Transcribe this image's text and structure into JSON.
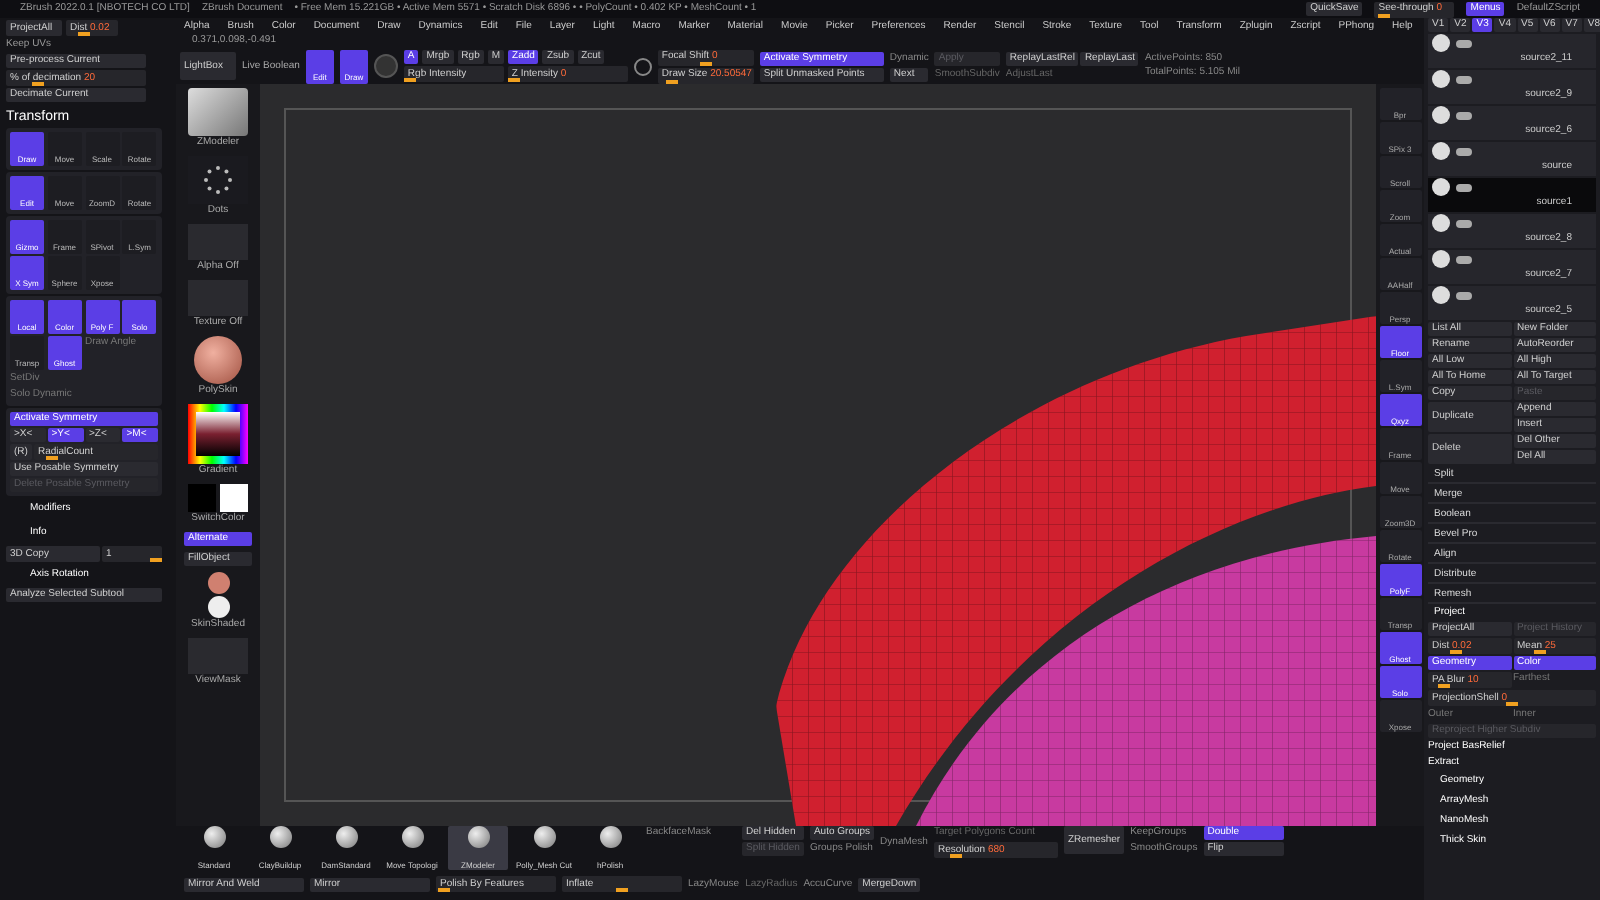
{
  "title_bar": {
    "app": "ZBrush 2022.0.1 [NBOTECH CO LTD]",
    "document": "ZBrush Document",
    "stats": "• Free Mem 15.221GB • Active Mem 5571 • Scratch Disk 6896 • • PolyCount • 0.402 KP • MeshCount • 1",
    "quick_save": "QuickSave",
    "see_through": {
      "label": "See-through",
      "value": "0",
      "level": 0.05
    },
    "menus_button": {
      "label": "Menus",
      "selected": true
    },
    "script": "DefaultZScript"
  },
  "menu_bar": [
    "Alpha",
    "Brush",
    "Color",
    "Document",
    "Draw",
    "Dynamics",
    "Edit",
    "File",
    "Layer",
    "Light",
    "Macro",
    "Marker",
    "Material",
    "Movie",
    "Picker",
    "Preferences",
    "Render",
    "Stencil",
    "Stroke",
    "Texture",
    "Tool",
    "Transform",
    "Zplugin",
    "Zscript",
    "PPhong",
    "Help"
  ],
  "decimation": {
    "project_all": "ProjectAll",
    "dist": {
      "label": "Dist",
      "value": "0.02",
      "level": 0.3
    },
    "keep_uvs": "Keep UVs",
    "pre_process": "Pre-process Current",
    "percent": {
      "label": "% of decimation",
      "value": "20",
      "level": 0.2
    },
    "decimate": "Decimate Current"
  },
  "toolbar": {
    "coordinates": "0.371,0.098,-0.491",
    "lightbox": "LightBox",
    "live_boolean": "Live Boolean",
    "modes": [
      {
        "label": "Edit",
        "selected": true
      },
      {
        "label": "Draw",
        "selected": true
      }
    ],
    "channels": [
      {
        "label": "A",
        "selected": true
      },
      {
        "label": "Mrgb",
        "selected": false
      },
      {
        "label": "Rgb",
        "selected": false
      },
      {
        "label": "M",
        "selected": false
      },
      {
        "label": "Zadd",
        "selected": true
      },
      {
        "label": "Zsub",
        "selected": false
      },
      {
        "label": "Zcut",
        "selected": false
      }
    ],
    "rgb_intensity": {
      "label": "Rgb Intensity",
      "level": 0
    },
    "z_intensity": {
      "label": "Z Intensity",
      "value": "0",
      "level": 0
    },
    "focal_shift": {
      "label": "Focal Shift",
      "value": "0",
      "level": 0.5
    },
    "draw_size": {
      "label": "Draw Size",
      "value": "20.50547",
      "level": 0.1
    },
    "symmetry": [
      {
        "label": "Activate Symmetry",
        "selected": true
      },
      {
        "label": "Split Unmasked Points",
        "selected": false
      }
    ],
    "dynamic": "Dynamic",
    "next": "Next",
    "apply": "Apply",
    "smooth_subdiv": "SmoothSubdiv",
    "adjust_last": "AdjustLast",
    "replay_rel": "ReplayLastRel",
    "replay_last": "ReplayLast",
    "active_points": "ActivePoints: 850",
    "total_points": "TotalPoints: 5.105 Mil"
  },
  "left_panel": {
    "title": "Transform",
    "groups": [
      [
        {
          "label": "Draw",
          "selected": true
        },
        {
          "label": "Move",
          "selected": false
        },
        {
          "label": "Scale",
          "selected": false
        },
        {
          "label": "Rotate",
          "selected": false
        }
      ],
      [
        {
          "label": "Edit",
          "selected": true
        },
        {
          "label": "Move",
          "selected": false
        },
        {
          "label": "ZoomD",
          "selected": false
        },
        {
          "label": "Rotate",
          "selected": false
        }
      ],
      [
        {
          "label": "Gizmo",
          "selected": true
        },
        {
          "label": "Frame",
          "selected": false
        },
        {
          "label": "SPivot",
          "selected": false
        },
        {
          "label": "L.Sym",
          "selected": false
        },
        {
          "label": "X Sym",
          "selected": true
        },
        {
          "label": "Sphere",
          "selected": false
        },
        {
          "label": "Xpose",
          "selected": false
        }
      ],
      [
        {
          "label": "Local",
          "selected": true
        },
        {
          "label": "Color",
          "selected": true
        },
        {
          "label": "Poly F",
          "selected": true
        },
        {
          "label": "Solo",
          "selected": true
        },
        {
          "label": "Transp",
          "selected": false
        },
        {
          "label": "Ghost",
          "selected": true
        }
      ]
    ],
    "draw_angle": "Draw Angle",
    "setdiv": "SetDiv",
    "solo_dynamic": "Solo Dynamic",
    "activate_symmetry": {
      "label": "Activate Symmetry",
      "selected": true
    },
    "axes": [
      {
        "label": ">X<",
        "selected": false
      },
      {
        "label": ">Y<",
        "selected": true
      },
      {
        "label": ">Z<",
        "selected": false
      },
      {
        "label": ">M<",
        "selected": true
      }
    ],
    "radial": {
      "label": "(R)",
      "slider": "RadialCount",
      "level": 0.1
    },
    "use_posable": "Use Posable Symmetry",
    "delete_posable": "Delete Posable Symmetry",
    "sections": [
      "Modifiers",
      "Info"
    ],
    "copy": {
      "label": "3D Copy",
      "value": "1",
      "level": 1
    },
    "axis_rotation": "Axis Rotation",
    "analyze": "Analyze Selected Subtool"
  },
  "materials": [
    {
      "label": "ZModeler",
      "kind": "cube"
    },
    {
      "label": "Dots",
      "kind": "dots"
    },
    {
      "label": "Alpha Off",
      "kind": "empty"
    },
    {
      "label": "Texture Off",
      "kind": "empty"
    },
    {
      "label": "PolySkin",
      "kind": "sphere"
    },
    {
      "label": "Gradient",
      "kind": "picker"
    },
    {
      "label": "SwitchColor",
      "kind": "swatches"
    },
    {
      "label": "Alternate",
      "kind": "button",
      "selected": true
    },
    {
      "label": "FillObject",
      "kind": "button",
      "selected": false
    },
    {
      "label": "SkinShaded",
      "kind": "spheres"
    },
    {
      "label": "ViewMask",
      "kind": "empty"
    }
  ],
  "right_shelf": [
    {
      "label": "Bpr",
      "selected": false
    },
    {
      "label": "SPix 3",
      "selected": false
    },
    {
      "label": "Scroll",
      "selected": false
    },
    {
      "label": "Zoom",
      "selected": false
    },
    {
      "label": "Actual",
      "selected": false
    },
    {
      "label": "AAHalf",
      "selected": false
    },
    {
      "label": "Persp",
      "selected": false
    },
    {
      "label": "Floor",
      "selected": true
    },
    {
      "label": "L.Sym",
      "selected": false
    },
    {
      "label": "Qxyz",
      "selected": true
    },
    {
      "label": "Frame",
      "selected": false
    },
    {
      "label": "Move",
      "selected": false
    },
    {
      "label": "Zoom3D",
      "selected": false
    },
    {
      "label": "Rotate",
      "selected": false
    },
    {
      "label": "PolyF",
      "selected": true
    },
    {
      "label": "Transp",
      "selected": false
    },
    {
      "label": "Ghost",
      "selected": true
    },
    {
      "label": "Solo",
      "selected": true
    },
    {
      "label": "Xpose",
      "selected": false
    }
  ],
  "subtool_panel": {
    "versions": [
      {
        "label": "V1",
        "selected": false
      },
      {
        "label": "V2",
        "selected": false
      },
      {
        "label": "V3",
        "selected": true
      },
      {
        "label": "V4",
        "selected": false
      },
      {
        "label": "V5",
        "selected": false
      },
      {
        "label": "V6",
        "selected": false
      },
      {
        "label": "V7",
        "selected": false
      },
      {
        "label": "V8",
        "selected": false
      }
    ],
    "subtools": [
      {
        "name": "source2_11",
        "selected": false
      },
      {
        "name": "source2_9",
        "selected": false
      },
      {
        "name": "source2_6",
        "selected": false
      },
      {
        "name": "source",
        "selected": false
      },
      {
        "name": "source1",
        "selected": true
      },
      {
        "name": "source2_8",
        "selected": false
      },
      {
        "name": "source2_7",
        "selected": false
      },
      {
        "name": "source2_5",
        "selected": false
      }
    ],
    "list_all": "List All",
    "new_folder": "New Folder",
    "buttons": [
      {
        "label": "Rename",
        "disabled": false
      },
      {
        "label": "AutoReorder",
        "disabled": false
      },
      {
        "label": "All Low",
        "disabled": false
      },
      {
        "label": "All High",
        "disabled": false
      },
      {
        "label": "All To Home",
        "disabled": false
      },
      {
        "label": "All To Target",
        "disabled": false
      },
      {
        "label": "Copy",
        "disabled": false
      },
      {
        "label": "Paste",
        "disabled": true
      }
    ],
    "duplicate": "Duplicate",
    "append": "Append",
    "insert": "Insert",
    "delete": "Delete",
    "del_other": "Del Other",
    "del_all": "Del All",
    "sections": [
      "Split",
      "Merge",
      "Boolean",
      "Bevel Pro",
      "Align",
      "Distribute",
      "Remesh"
    ],
    "project": {
      "title": "Project",
      "project_all": "ProjectAll",
      "history": "Project History",
      "dist": {
        "label": "Dist",
        "value": "0.02",
        "level": 0.3
      },
      "mean": {
        "label": "Mean",
        "value": "25",
        "level": 0.3
      },
      "geometry": {
        "label": "Geometry",
        "selected": true
      },
      "color": {
        "label": "Color",
        "selected": true
      },
      "pa_blur": {
        "label": "PA Blur",
        "value": "10",
        "level": 0.15
      },
      "farthest": "Farthest",
      "shell": {
        "label": "ProjectionShell",
        "value": "0",
        "level": 0.5
      },
      "outer": "Outer",
      "inner": "Inner",
      "reproject": "Reproject Higher Subdiv",
      "basrelief": "Project BasRelief",
      "extract": "Extract"
    },
    "more": [
      "Geometry",
      "ArrayMesh",
      "NanoMesh",
      "Thick Skin"
    ]
  },
  "bottom_bar": {
    "brushes": [
      {
        "label": "Standard",
        "selected": false
      },
      {
        "label": "ClayBuildup",
        "selected": false
      },
      {
        "label": "DamStandard",
        "selected": false
      },
      {
        "label": "Move Topologi",
        "selected": false
      },
      {
        "label": "ZModeler",
        "selected": true
      },
      {
        "label": "Polly_Mesh Cut",
        "selected": false
      },
      {
        "label": "hPolish",
        "selected": false
      }
    ],
    "backface": "BackfaceMask",
    "del_hidden": "Del Hidden",
    "split_hidden": "Split Hidden",
    "auto_groups": "Auto Groups",
    "groups_polish": "Groups Polish",
    "dynamesh": "DynaMesh",
    "target": "Target Polygons Count",
    "resolution": {
      "label": "Resolution",
      "value": "680",
      "level": 0.15
    },
    "zremesher": "ZRemesher",
    "keep_groups": "KeepGroups",
    "smooth_groups": "SmoothGroups",
    "double": {
      "label": "Double",
      "selected": true
    },
    "flip": "Flip",
    "mirror_weld": "Mirror And Weld",
    "mirror": "Mirror",
    "polish": {
      "label": "Polish By Features",
      "level": 0.02
    },
    "inflate": {
      "label": "Inflate",
      "level": 0.5
    },
    "lazy_mouse": "LazyMouse",
    "lazy_radius": "LazyRadius",
    "accucurve": "AccuCurve",
    "merge_down": "MergeDown"
  }
}
